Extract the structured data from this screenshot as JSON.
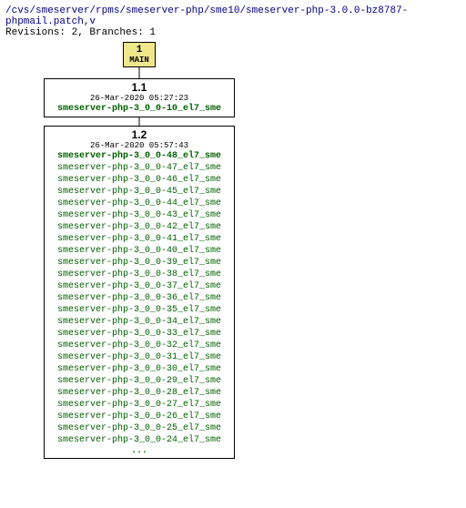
{
  "header": {
    "path": "/cvs/smeserver/rpms/smeserver-php/sme10/smeserver-php-3.0.0-bz8787-phpmail.patch,v",
    "revisions_line": "Revisions: 2, Branches: 1"
  },
  "nodes": {
    "main": {
      "num": "1",
      "label": "MAIN"
    },
    "rev11": {
      "num": "1.1",
      "date": "26-Mar-2020 05:27:23",
      "tags": [
        "smeserver-php-3_0_0-10_el7_sme"
      ]
    },
    "rev12": {
      "num": "1.2",
      "date": "26-Mar-2020 05:57:43",
      "tags": [
        "smeserver-php-3_0_0-48_el7_sme",
        "smeserver-php-3_0_0-47_el7_sme",
        "smeserver-php-3_0_0-46_el7_sme",
        "smeserver-php-3_0_0-45_el7_sme",
        "smeserver-php-3_0_0-44_el7_sme",
        "smeserver-php-3_0_0-43_el7_sme",
        "smeserver-php-3_0_0-42_el7_sme",
        "smeserver-php-3_0_0-41_el7_sme",
        "smeserver-php-3_0_0-40_el7_sme",
        "smeserver-php-3_0_0-39_el7_sme",
        "smeserver-php-3_0_0-38_el7_sme",
        "smeserver-php-3_0_0-37_el7_sme",
        "smeserver-php-3_0_0-36_el7_sme",
        "smeserver-php-3_0_0-35_el7_sme",
        "smeserver-php-3_0_0-34_el7_sme",
        "smeserver-php-3_0_0-33_el7_sme",
        "smeserver-php-3_0_0-32_el7_sme",
        "smeserver-php-3_0_0-31_el7_sme",
        "smeserver-php-3_0_0-30_el7_sme",
        "smeserver-php-3_0_0-29_el7_sme",
        "smeserver-php-3_0_0-28_el7_sme",
        "smeserver-php-3_0_0-27_el7_sme",
        "smeserver-php-3_0_0-26_el7_sme",
        "smeserver-php-3_0_0-25_el7_sme",
        "smeserver-php-3_0_0-24_el7_sme"
      ],
      "ellipsis": "..."
    }
  }
}
